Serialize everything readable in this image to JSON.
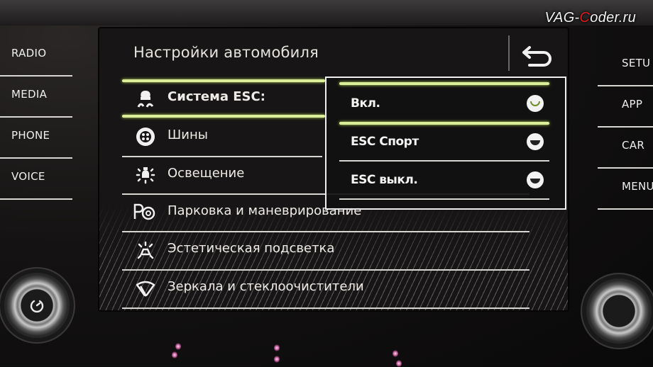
{
  "watermark": {
    "prefix": "VAG-",
    "accent": "C",
    "suffix": "oder.ru",
    "accent_color": "#e21c1c"
  },
  "left_buttons": [
    {
      "label": "RADIO"
    },
    {
      "label": "MEDIA"
    },
    {
      "label": "PHONE"
    },
    {
      "label": "VOICE"
    }
  ],
  "right_buttons": [
    {
      "label": "SETU"
    },
    {
      "label": "APP"
    },
    {
      "label": "CAR"
    },
    {
      "label": "MENU"
    }
  ],
  "screen": {
    "title": "Настройки автомобиля",
    "back_icon": "back-arrow-icon",
    "menu_items": [
      {
        "label": "Система ESC:",
        "icon": "esc-skid-icon",
        "active": true
      },
      {
        "label": "Шины",
        "icon": "tire-icon",
        "active": false
      },
      {
        "label": "Освещение",
        "icon": "light-bulb-icon",
        "active": false
      },
      {
        "label": "Парковка и маневрирование",
        "icon": "parking-icon",
        "active": false
      },
      {
        "label": "Эстетическая подсветка",
        "icon": "ambient-light-icon",
        "active": false
      },
      {
        "label": "Зеркала и стеклоочистители",
        "icon": "wiper-icon",
        "active": false
      }
    ],
    "esc_popup": {
      "options": [
        {
          "label": "Вкл.",
          "selected": true
        },
        {
          "label": "ESC Спорт",
          "selected": false
        },
        {
          "label": "ESC выкл.",
          "selected": false
        }
      ]
    }
  },
  "accent_color": "#dcee9a",
  "knob_left_icon": "power-icon"
}
